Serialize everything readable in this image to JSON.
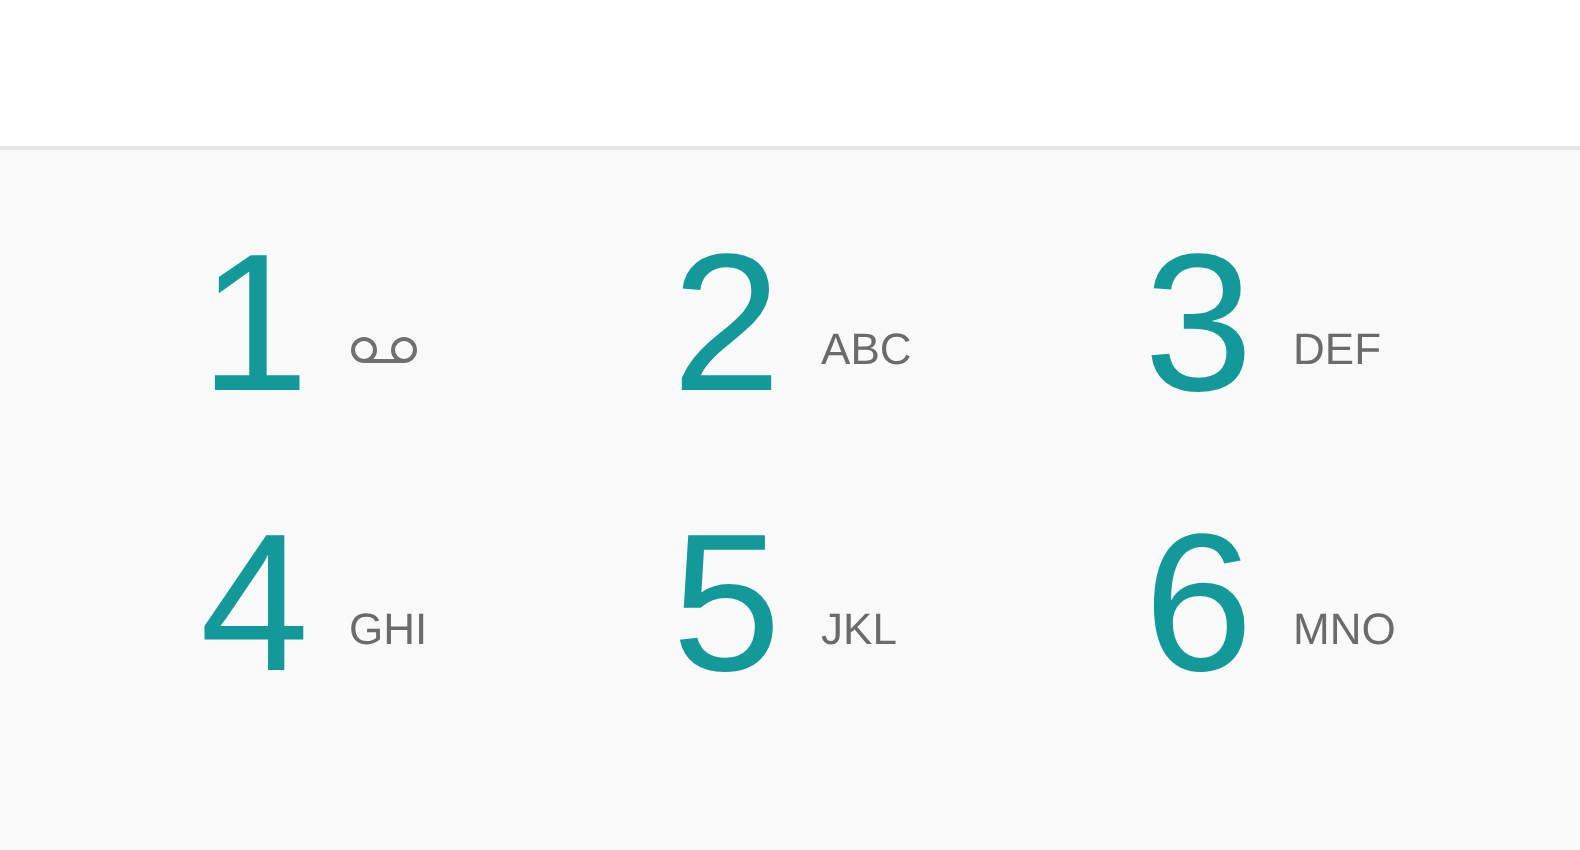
{
  "keys": [
    {
      "digit": "1",
      "kind": "voicemail"
    },
    {
      "digit": "2",
      "kind": "letters",
      "letters": "ABC"
    },
    {
      "digit": "3",
      "kind": "letters",
      "letters": "DEF"
    },
    {
      "digit": "4",
      "kind": "letters",
      "letters": "GHI"
    },
    {
      "digit": "5",
      "kind": "letters",
      "letters": "JKL"
    },
    {
      "digit": "6",
      "kind": "letters",
      "letters": "MNO"
    }
  ]
}
